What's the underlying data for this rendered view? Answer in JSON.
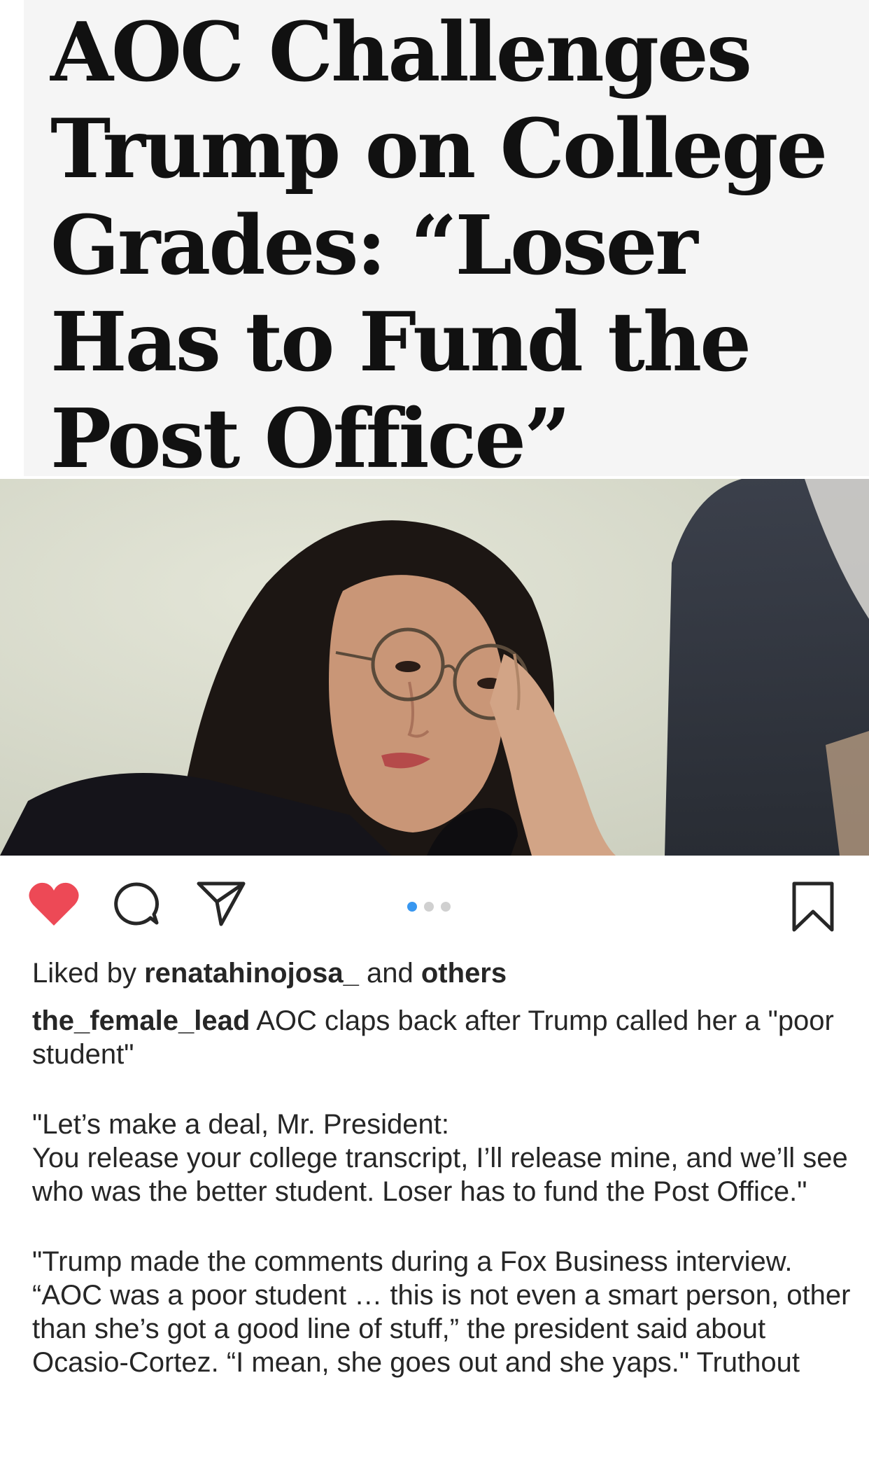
{
  "post": {
    "headline": "AOC Challenges Trump on College Grades: “Loser Has to Fund the Post Office”"
  },
  "carousel": {
    "count": 3,
    "active_index": 0,
    "active_color": "#3897f0"
  },
  "actions": {
    "heart_icon": "heart-filled",
    "heart_color": "#ed4956",
    "comment_icon": "speech-bubble",
    "share_icon": "paper-plane",
    "bookmark_icon": "bookmark"
  },
  "likes": {
    "prefix": "Liked by",
    "user": "renatahinojosa_",
    "connector": "and",
    "others": "others"
  },
  "caption": {
    "username": "the_female_lead",
    "text": "AOC claps back after Trump called her a \"poor student\"",
    "quote1_line1": "\"Let’s make a deal, Mr. President:",
    "quote1_line2": "You release your college transcript, I’ll release mine, and we’ll see who was the better student. Loser has to fund the Post Office.\"",
    "quote2": "\"Trump made the comments during a Fox Business interview. “AOC was a poor student … this is not even a smart person, other than she’s got a good line of stuff,” the president said about Ocasio-Cortez. “I mean, she goes out and she yaps.\" Truthout"
  }
}
